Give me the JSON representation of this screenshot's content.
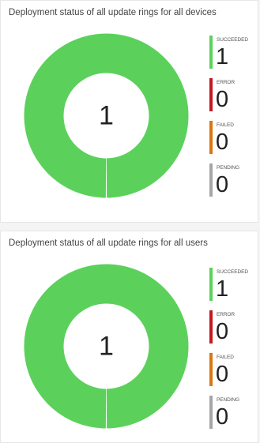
{
  "chart_data": [
    {
      "type": "pie",
      "donut": true,
      "title": "Deployment status of all update rings for all devices",
      "center_value": "1",
      "categories": [
        "SUCCEEDED",
        "ERROR",
        "FAILED",
        "PENDING"
      ],
      "values": [
        1,
        0,
        0,
        0
      ],
      "display_values": [
        "1",
        "0",
        "0",
        "0"
      ],
      "colors": [
        "#5bd15b",
        "#c4191f",
        "#d9770f",
        "#a6a6a6"
      ],
      "legend_position": "right"
    },
    {
      "type": "pie",
      "donut": true,
      "title": "Deployment status of all update rings for all users",
      "center_value": "1",
      "categories": [
        "SUCCEEDED",
        "ERROR",
        "FAILED",
        "PENDING"
      ],
      "values": [
        1,
        0,
        0,
        0
      ],
      "display_values": [
        "1",
        "0",
        "0",
        "0"
      ],
      "colors": [
        "#5bd15b",
        "#c4191f",
        "#d9770f",
        "#a6a6a6"
      ],
      "legend_position": "right"
    }
  ]
}
